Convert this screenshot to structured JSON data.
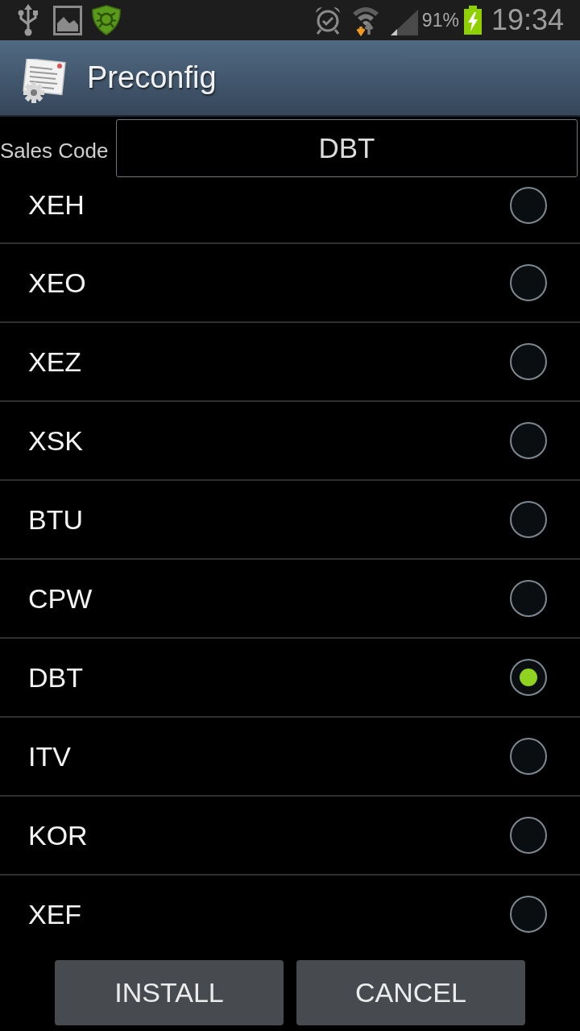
{
  "status_bar": {
    "battery": "91%",
    "time": "19:34"
  },
  "title_bar": {
    "title": "Preconfig"
  },
  "sales_code": {
    "label": "Sales Code",
    "value": "DBT"
  },
  "options": [
    {
      "label": "XEH",
      "selected": false
    },
    {
      "label": "XEO",
      "selected": false
    },
    {
      "label": "XEZ",
      "selected": false
    },
    {
      "label": "XSK",
      "selected": false
    },
    {
      "label": "BTU",
      "selected": false
    },
    {
      "label": "CPW",
      "selected": false
    },
    {
      "label": "DBT",
      "selected": true
    },
    {
      "label": "ITV",
      "selected": false
    },
    {
      "label": "KOR",
      "selected": false
    },
    {
      "label": "XEF",
      "selected": false
    }
  ],
  "buttons": [
    {
      "label": "INSTALL"
    },
    {
      "label": "CANCEL"
    }
  ]
}
